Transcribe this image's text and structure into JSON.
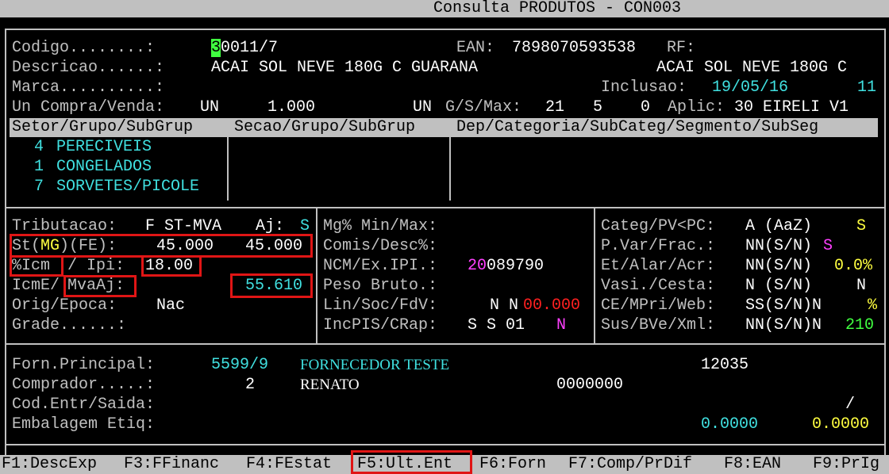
{
  "window": {
    "title": "Consulta PRODUTOS - CON003"
  },
  "header": {
    "codigo_label": "Codigo........:",
    "codigo_cursor": "3",
    "codigo_value": "0011/7",
    "ean_label": "EAN:",
    "ean_value": "7898070593538",
    "rf_label": "RF:",
    "descricao_label": "Descricao......:",
    "descricao_value": "ACAI SOL NEVE 180G C GUARANA",
    "descricao_short": "ACAI SOL NEVE 180G C",
    "marca_label": "Marca..........:",
    "inclusao_label": "Inclusao:",
    "inclusao_date": "19/05/16",
    "inclusao_num": "11",
    "uncompra_label": "Un Compra/Venda:",
    "un_compra": "UN",
    "qtd": "1.000",
    "un_venda": "UN",
    "gsmax_label": "G/S/Max:",
    "gsmax_values": "21   5    0",
    "aplic_label": "Aplic:",
    "aplic_value": "30 EIRELI V1"
  },
  "category_headers": {
    "col1": "Setor/Grupo/SubGrup",
    "col2": "Secao/Grupo/SubGrup",
    "col3": "Dep/Categoria/SubCateg/Segmento/SubSeg"
  },
  "categories": [
    {
      "num": "4",
      "name": "PERECIVEIS"
    },
    {
      "num": "1",
      "name": "CONGELADOS"
    },
    {
      "num": "7",
      "name": "SORVETES/PICOLE"
    }
  ],
  "tax": {
    "tributacao_label": "Tributacao:",
    "tributacao_value": "F ST-MVA",
    "aj_label": "Aj:",
    "aj_value": "S",
    "st_label_1": "St(",
    "st_state": "MG",
    "st_label_2": ")(FE):",
    "st_value_1": "45.000",
    "st_value_2": "45.000",
    "icm_label": "%Icm",
    "ipi_label": "/ Ipi:",
    "icm_value": "18.00",
    "icme_label": "IcmE/",
    "mvaaj_label": "MvaAj:",
    "mva_value": "55.610",
    "orig_label": "Orig/Epoca:",
    "orig_value": "Nac",
    "grade_label": "Grade......:"
  },
  "mid": {
    "mg_label": "Mg% Min/Max:",
    "comis_label": "Comis/Desc%:",
    "ncm_label": "NCM/Ex.IPI.:",
    "ncm_prefix": "20",
    "ncm_rest": "089790",
    "peso_label": "Peso Bruto.:",
    "lin_label": "Lin/Soc/FdV:",
    "lin_value": "N N",
    "lin_red": "00.000",
    "inc_label": "IncPIS/CRap:",
    "inc_value": "S S 01",
    "inc_flag": "N"
  },
  "right": {
    "categ_label": "Categ/PV<PC:",
    "categ_value": "A (AaZ)",
    "categ_flag": "S",
    "pvar_label": "P.Var/Frac.:",
    "pvar_value": "NN(S/N)",
    "pvar_flag": "S",
    "et_label": "Et/Alar/Acr:",
    "et_value": "NN(S/N)",
    "et_pct": "0.0%",
    "vasi_label": "Vasi./Cesta:",
    "vasi_value": "N (S/N)",
    "vasi_flag": "N",
    "ce_label": "CE/MPri/Web:",
    "ce_value": "SS(S/N)N",
    "ce_pct": "%",
    "sus_label": "Sus/BVe/Xml:",
    "sus_value": "NN(S/N)N",
    "sus_num": "210"
  },
  "supplier": {
    "forn_label": "Forn.Principal:",
    "forn_code": "5599/9",
    "forn_name": "FORNECEDOR TESTE",
    "forn_num": "12035",
    "comp_label": "Comprador.....:",
    "comp_code": "2",
    "comp_name": "RENATO",
    "comp_num": "0000000",
    "cod_label": "Cod.Entr/Saida:",
    "cod_slash": "/",
    "emb_label": "Embalagem Etiq:",
    "emb_value_1": "0.0000",
    "emb_value_2": "0.0000"
  },
  "function_keys": {
    "f1": "F1:DescExp",
    "f3": "F3:FFinanc",
    "f4": "F4:FEstat",
    "f5": "F5:Ult.Ent",
    "f6": "F6:Forn",
    "f7": "F7:Comp/PrDif",
    "f8": "F8:EAN",
    "f9": "F9:PrIg"
  }
}
